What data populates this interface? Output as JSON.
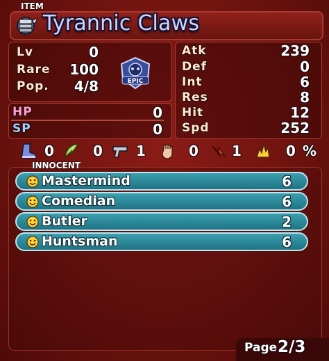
{
  "section_label": "ITEM",
  "item": {
    "name": "Tyrannic Claws",
    "icon": "claw-gauntlet-icon",
    "rarity_badge": "EPIC",
    "colors": {
      "title": "#c9d8ff",
      "panel": "#8c1c17",
      "innocent_row": "#2a8a9b"
    }
  },
  "left_stats": [
    {
      "label": "Lv",
      "value": "0"
    },
    {
      "label": "Rare",
      "value": "100"
    },
    {
      "label": "Pop.",
      "value": "4/8"
    }
  ],
  "resource_stats": [
    {
      "label": "HP",
      "value": "0"
    },
    {
      "label": "SP",
      "value": "0"
    }
  ],
  "right_stats": [
    {
      "label": "Atk",
      "value": "239"
    },
    {
      "label": "Def",
      "value": "0"
    },
    {
      "label": "Int",
      "value": "6"
    },
    {
      "label": "Res",
      "value": "8"
    },
    {
      "label": "Hit",
      "value": "12"
    },
    {
      "label": "Spd",
      "value": "252"
    }
  ],
  "resistances": [
    {
      "icon": "boot-icon",
      "value": "0"
    },
    {
      "icon": "feather-icon",
      "value": "0"
    },
    {
      "icon": "gun-icon",
      "value": "1"
    },
    {
      "icon": "fist-icon",
      "value": "0"
    },
    {
      "icon": "arrow-icon",
      "value": "1"
    },
    {
      "icon": "fire-icon",
      "value": "0"
    }
  ],
  "fire_unit": "%",
  "innocent_label": "INNOCENT",
  "innocents": [
    {
      "name": "Mastermind",
      "level": "6"
    },
    {
      "name": "Comedian",
      "level": "6"
    },
    {
      "name": "Butler",
      "level": "2"
    },
    {
      "name": "Huntsman",
      "level": "6"
    }
  ],
  "page": {
    "label": "Page",
    "current": "2/3"
  }
}
